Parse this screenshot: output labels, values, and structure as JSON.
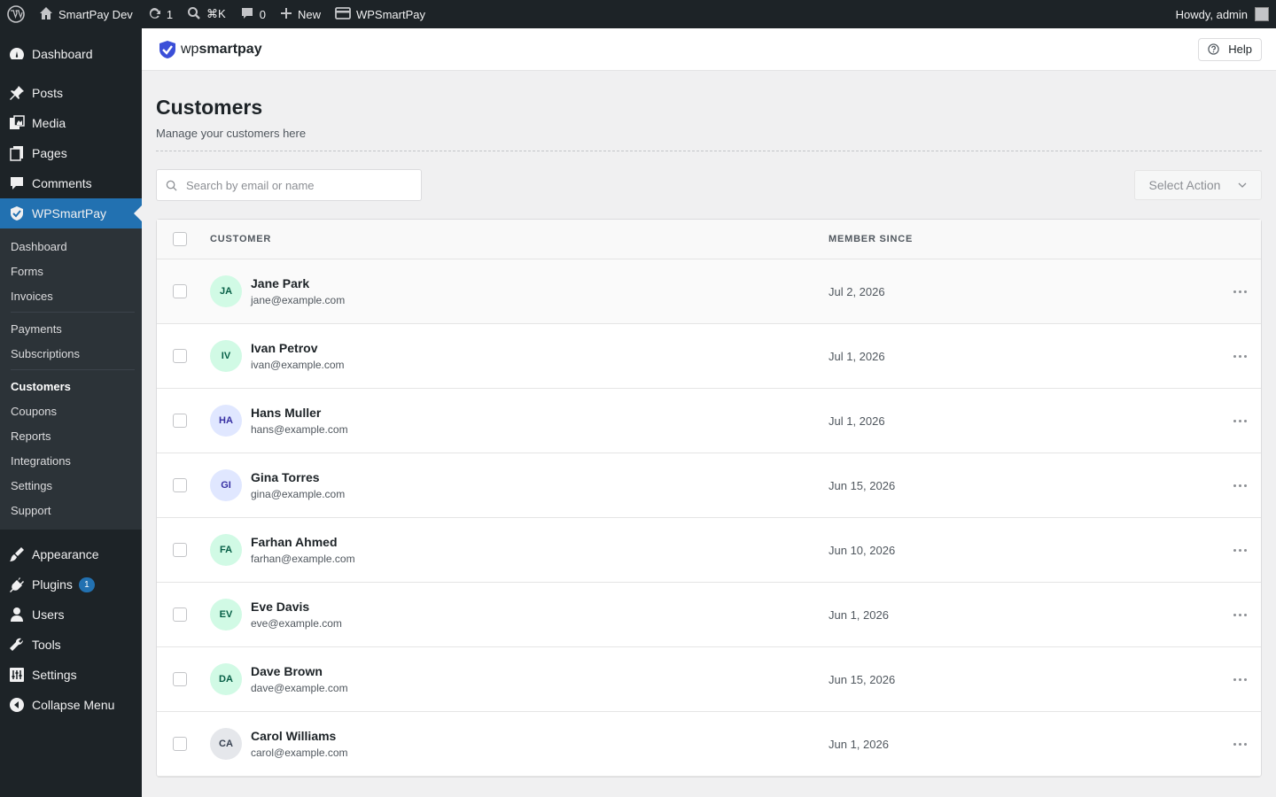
{
  "adminbar": {
    "site_name": "SmartPay Dev",
    "updates_count": "1",
    "search_shortcut": "⌘K",
    "comments_count": "0",
    "new_label": "New",
    "plugin_label": "WPSmartPay",
    "howdy": "Howdy, admin"
  },
  "sidebar": {
    "dashboard": "Dashboard",
    "posts": "Posts",
    "media": "Media",
    "pages": "Pages",
    "comments": "Comments",
    "wpsmartpay": "WPSmartPay",
    "sub": {
      "dashboard": "Dashboard",
      "forms": "Forms",
      "invoices": "Invoices",
      "payments": "Payments",
      "subscriptions": "Subscriptions",
      "customers": "Customers",
      "coupons": "Coupons",
      "reports": "Reports",
      "integrations": "Integrations",
      "settings": "Settings",
      "support": "Support"
    },
    "appearance": "Appearance",
    "plugins": "Plugins",
    "plugins_badge": "1",
    "users": "Users",
    "tools": "Tools",
    "settings": "Settings",
    "collapse": "Collapse Menu"
  },
  "header": {
    "logo_wp": "wp",
    "logo_rest": "smartpay",
    "help": "Help"
  },
  "page": {
    "title": "Customers",
    "subtitle": "Manage your customers here",
    "search_placeholder": "Search by email or name",
    "select_action": "Select Action"
  },
  "table": {
    "col_customer": "CUSTOMER",
    "col_member_since": "MEMBER SINCE",
    "rows": [
      {
        "initials": "JA",
        "name": "Jane Park",
        "email": "jane@example.com",
        "since": "Jul 2, 2026",
        "bg": "#d1fae5",
        "fg": "#065f46"
      },
      {
        "initials": "IV",
        "name": "Ivan Petrov",
        "email": "ivan@example.com",
        "since": "Jul 1, 2026",
        "bg": "#d1fae5",
        "fg": "#065f46"
      },
      {
        "initials": "HA",
        "name": "Hans Muller",
        "email": "hans@example.com",
        "since": "Jul 1, 2026",
        "bg": "#e0e7ff",
        "fg": "#3730a3"
      },
      {
        "initials": "GI",
        "name": "Gina Torres",
        "email": "gina@example.com",
        "since": "Jun 15, 2026",
        "bg": "#e0e7ff",
        "fg": "#3730a3"
      },
      {
        "initials": "FA",
        "name": "Farhan Ahmed",
        "email": "farhan@example.com",
        "since": "Jun 10, 2026",
        "bg": "#d1fae5",
        "fg": "#065f46"
      },
      {
        "initials": "EV",
        "name": "Eve Davis",
        "email": "eve@example.com",
        "since": "Jun 1, 2026",
        "bg": "#d1fae5",
        "fg": "#065f46"
      },
      {
        "initials": "DA",
        "name": "Dave Brown",
        "email": "dave@example.com",
        "since": "Jun 15, 2026",
        "bg": "#d1fae5",
        "fg": "#065f46"
      },
      {
        "initials": "CA",
        "name": "Carol Williams",
        "email": "carol@example.com",
        "since": "Jun 1, 2026",
        "bg": "#e5e7eb",
        "fg": "#374151"
      }
    ]
  }
}
